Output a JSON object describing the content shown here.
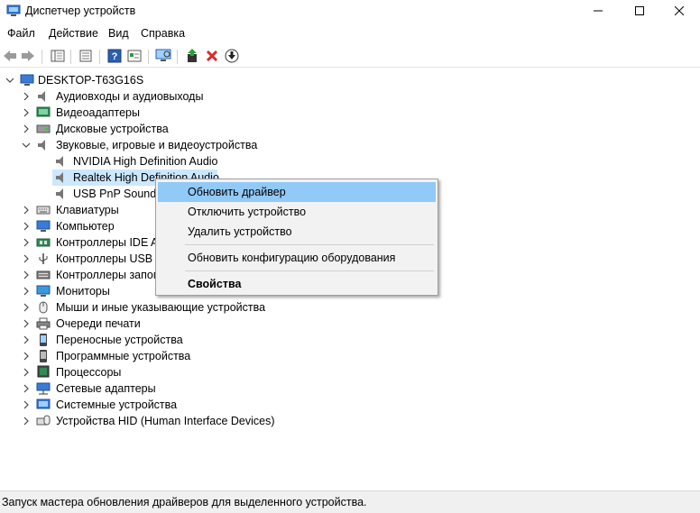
{
  "window": {
    "title": "Диспетчер устройств"
  },
  "menu": [
    "Файл",
    "Действие",
    "Вид",
    "Справка"
  ],
  "tree": {
    "root": "DESKTOP-T63G16S",
    "categories": [
      "Аудиовходы и аудиовыходы",
      "Видеоадаптеры",
      "Дисковые устройства",
      "Звуковые, игровые и видеоустройства"
    ],
    "sound_children": [
      "NVIDIA High Definition Audio",
      "Realtek High Definition Audio",
      "USB PnP Sound D"
    ],
    "more_categories": [
      "Клавиатуры",
      "Компьютер",
      "Контроллеры IDE AT",
      "Контроллеры USB",
      "Контроллеры запом",
      "Мониторы",
      "Мыши и иные указывающие устройства",
      "Очереди печати",
      "Переносные устройства",
      "Программные устройства",
      "Процессоры",
      "Сетевые адаптеры",
      "Системные устройства",
      "Устройства HID (Human Interface Devices)"
    ]
  },
  "context_menu": {
    "update_driver": "Обновить драйвер",
    "disable_device": "Отключить устройство",
    "uninstall_device": "Удалить устройство",
    "scan_hardware": "Обновить конфигурацию оборудования",
    "properties": "Свойства"
  },
  "status": {
    "text": "Запуск мастера обновления драйверов для выделенного устройства."
  },
  "colors": {
    "selection": "#cce8ff",
    "menu_highlight": "#91c9f7",
    "remove_red": "#d62b2b"
  }
}
